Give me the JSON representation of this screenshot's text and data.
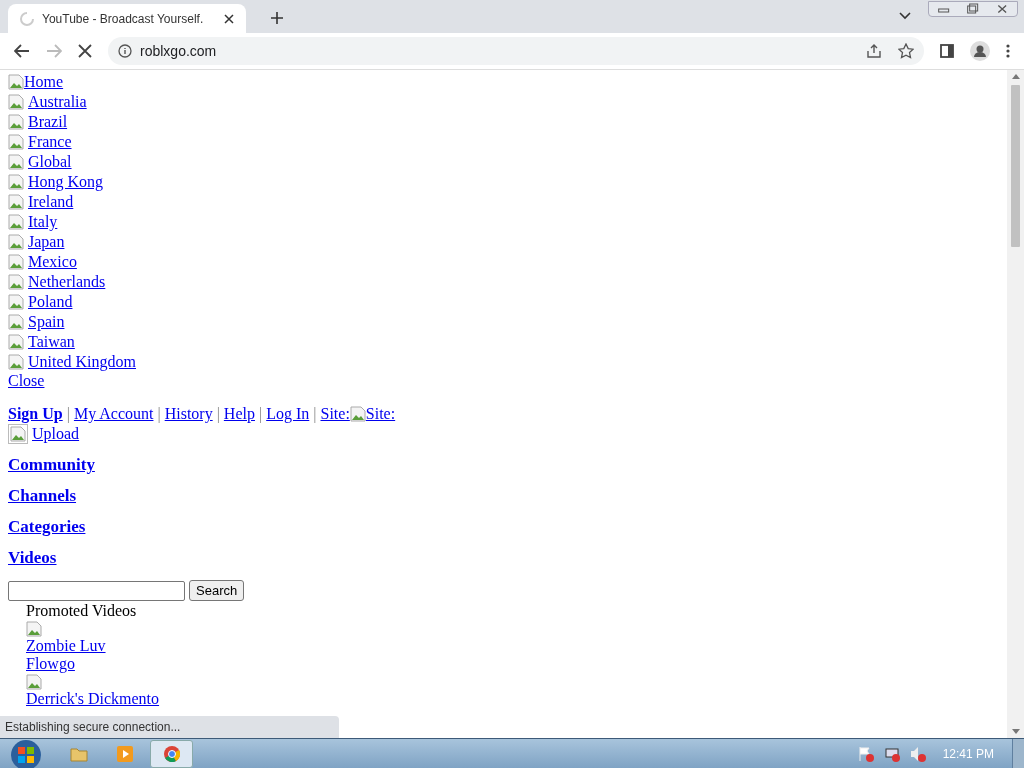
{
  "browser": {
    "tab_title": "YouTube - Broadcast Yourself.",
    "url": "roblxgo.com",
    "loading": true,
    "status": "Establishing secure connection..."
  },
  "home_link": "Home",
  "countries": [
    "Australia",
    "Brazil",
    "France",
    "Global",
    "Hong Kong",
    "Ireland",
    "Italy",
    "Japan",
    "Mexico",
    "Netherlands",
    "Poland",
    "Spain",
    "Taiwan",
    "United Kingdom"
  ],
  "close_link": "Close",
  "user_nav": [
    {
      "label": "Sign Up",
      "bold": true
    },
    {
      "label": "My Account",
      "bold": false
    },
    {
      "label": "History",
      "bold": false
    },
    {
      "label": "Help",
      "bold": false
    },
    {
      "label": "Log In",
      "bold": false
    },
    {
      "label": "Site:",
      "bold": false
    }
  ],
  "separator": "|",
  "site_image_alt": "Site:",
  "upload_link": "Upload",
  "sections": [
    "Community",
    "Channels",
    "Categories",
    "Videos"
  ],
  "search": {
    "button": "Search"
  },
  "promoted": {
    "title": "Promoted Videos",
    "items": [
      {
        "kind": "image"
      },
      {
        "kind": "link",
        "label": "Zombie Luv"
      },
      {
        "kind": "link",
        "label": "Flowgo"
      },
      {
        "kind": "image"
      },
      {
        "kind": "link",
        "label": "Derrick's Dickmento"
      }
    ]
  },
  "taskbar": {
    "clock": "12:41 PM"
  }
}
